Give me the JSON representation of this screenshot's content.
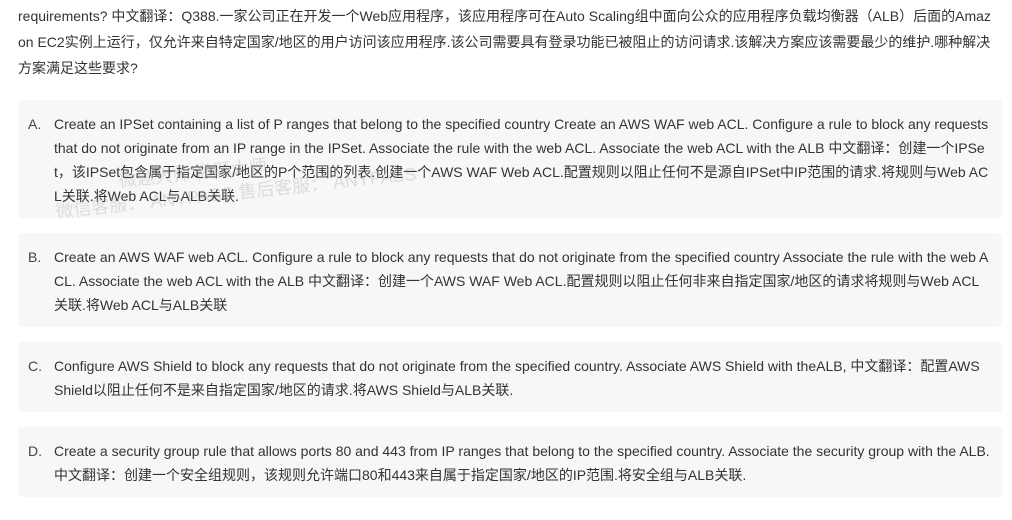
{
  "question": {
    "text": "requirements? 中文翻译：Q388.一家公司正在开发一个Web应用程序，该应用程序可在Auto Scaling组中面向公众的应用程序负载均衡器（ALB）后面的Amazon EC2实例上运行，仅允许来自特定国家/地区的用户访问该应用程序.该公司需要具有登录功能已被阻止的访问请求.该解决方案应该需要最少的维护.哪种解决方案满足这些要求?"
  },
  "options": [
    {
      "letter": "A.",
      "text": "Create an IPSet containing a list of P ranges that belong to the specified country Create an AWS WAF web ACL. Configure a rule to block any requests that do not originate from an IP range in the IPSet. Associate the rule with the web ACL. Associate the web ACL with the ALB 中文翻译：创建一个IPSet，该IPSet包含属于指定国家/地区的P个范围的列表.创建一个AWS WAF Web ACL.配置规则以阻止任何不是源自IPSet中IP范围的请求.将规则与Web ACL关联.将Web ACL与ALB关联."
    },
    {
      "letter": "B.",
      "text": "Create an AWS WAF web ACL. Configure a rule to block any requests that do not originate from the specified country Associate the rule with the web ACL. Associate the web ACL with the ALB 中文翻译：创建一个AWS WAF Web ACL.配置规则以阻止任何非来自指定国家/地区的请求将规则与Web ACL关联.将Web ACL与ALB关联"
    },
    {
      "letter": "C.",
      "text": "Configure AWS Shield to block any requests that do not originate from the specified country. Associate AWS Shield with theALB, 中文翻译：配置AWS Shield以阻止任何不是来自指定国家/地区的请求.将AWS Shield与ALB关联."
    },
    {
      "letter": "D.",
      "text": "Create a security group rule that allows ports 80 and 443 from IP ranges that belong to the specified country. Associate the security group with the ALB. 中文翻译：创建一个安全组规则，该规则允许端口80和443来自属于指定国家/地区的IP范围.将安全组与ALB关联."
    }
  ],
  "watermark": {
    "line1": "微题大师 微题大师",
    "line2": "微信客服： ANYPASS 售后客服： ANYPASS"
  }
}
